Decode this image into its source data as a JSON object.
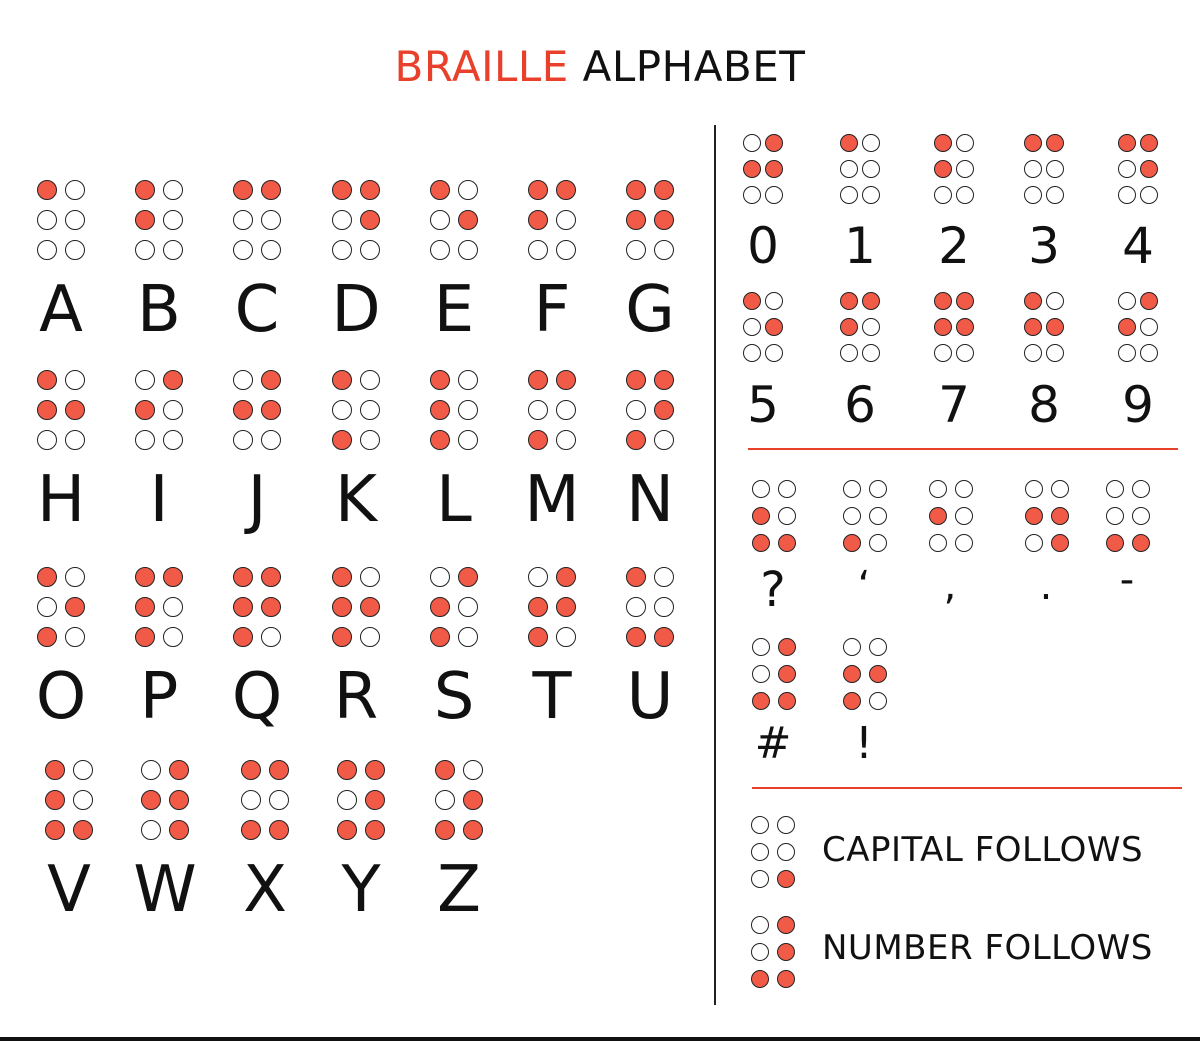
{
  "title": {
    "accent": "BRAILLE",
    "rest": "ALPHABET"
  },
  "colors": {
    "accent": "#e8402a",
    "dot_fill": "#f05a46",
    "outline": "#222222"
  },
  "letters": [
    {
      "label": "A",
      "dots": [
        1
      ]
    },
    {
      "label": "B",
      "dots": [
        1,
        2
      ]
    },
    {
      "label": "C",
      "dots": [
        1,
        4
      ]
    },
    {
      "label": "D",
      "dots": [
        1,
        4,
        5
      ]
    },
    {
      "label": "E",
      "dots": [
        1,
        5
      ]
    },
    {
      "label": "F",
      "dots": [
        1,
        2,
        4
      ]
    },
    {
      "label": "G",
      "dots": [
        1,
        2,
        4,
        5
      ]
    },
    {
      "label": "H",
      "dots": [
        1,
        2,
        5
      ]
    },
    {
      "label": "I",
      "dots": [
        2,
        4
      ]
    },
    {
      "label": "J",
      "dots": [
        2,
        4,
        5
      ]
    },
    {
      "label": "K",
      "dots": [
        1,
        3
      ]
    },
    {
      "label": "L",
      "dots": [
        1,
        2,
        3
      ]
    },
    {
      "label": "M",
      "dots": [
        1,
        3,
        4
      ]
    },
    {
      "label": "N",
      "dots": [
        1,
        3,
        4,
        5
      ]
    },
    {
      "label": "O",
      "dots": [
        1,
        3,
        5
      ]
    },
    {
      "label": "P",
      "dots": [
        1,
        2,
        3,
        4
      ]
    },
    {
      "label": "Q",
      "dots": [
        1,
        2,
        3,
        4,
        5
      ]
    },
    {
      "label": "R",
      "dots": [
        1,
        2,
        3,
        5
      ]
    },
    {
      "label": "S",
      "dots": [
        2,
        3,
        4
      ]
    },
    {
      "label": "T",
      "dots": [
        2,
        3,
        4,
        5
      ]
    },
    {
      "label": "U",
      "dots": [
        1,
        3,
        6
      ]
    },
    {
      "label": "V",
      "dots": [
        1,
        2,
        3,
        6
      ]
    },
    {
      "label": "W",
      "dots": [
        2,
        4,
        5,
        6
      ]
    },
    {
      "label": "X",
      "dots": [
        1,
        3,
        4,
        6
      ]
    },
    {
      "label": "Y",
      "dots": [
        1,
        3,
        4,
        5,
        6
      ]
    },
    {
      "label": "Z",
      "dots": [
        1,
        3,
        5,
        6
      ]
    }
  ],
  "numbers": [
    {
      "label": "0",
      "dots": [
        2,
        4,
        5
      ]
    },
    {
      "label": "1",
      "dots": [
        1
      ]
    },
    {
      "label": "2",
      "dots": [
        1,
        2
      ]
    },
    {
      "label": "3",
      "dots": [
        1,
        4
      ]
    },
    {
      "label": "4",
      "dots": [
        1,
        4,
        5
      ]
    },
    {
      "label": "5",
      "dots": [
        1,
        5
      ]
    },
    {
      "label": "6",
      "dots": [
        1,
        2,
        4
      ]
    },
    {
      "label": "7",
      "dots": [
        1,
        2,
        4,
        5
      ]
    },
    {
      "label": "8",
      "dots": [
        1,
        2,
        5
      ]
    },
    {
      "label": "9",
      "dots": [
        2,
        4
      ]
    }
  ],
  "punctuation": [
    {
      "label": "?",
      "dots": [
        2,
        3,
        6
      ]
    },
    {
      "label": "‘",
      "dots": [
        3
      ]
    },
    {
      "label": ",",
      "dots": [
        2
      ]
    },
    {
      "label": ".",
      "dots": [
        2,
        5,
        6
      ]
    },
    {
      "label": "-",
      "dots": [
        3,
        6
      ]
    },
    {
      "label": "#",
      "dots": [
        3,
        4,
        5,
        6
      ]
    },
    {
      "label": "!",
      "dots": [
        2,
        3,
        5
      ]
    }
  ],
  "legend": [
    {
      "label": "CAPITAL FOLLOWS",
      "dots": [
        6
      ]
    },
    {
      "label": "NUMBER FOLLOWS",
      "dots": [
        3,
        4,
        5,
        6
      ]
    }
  ]
}
